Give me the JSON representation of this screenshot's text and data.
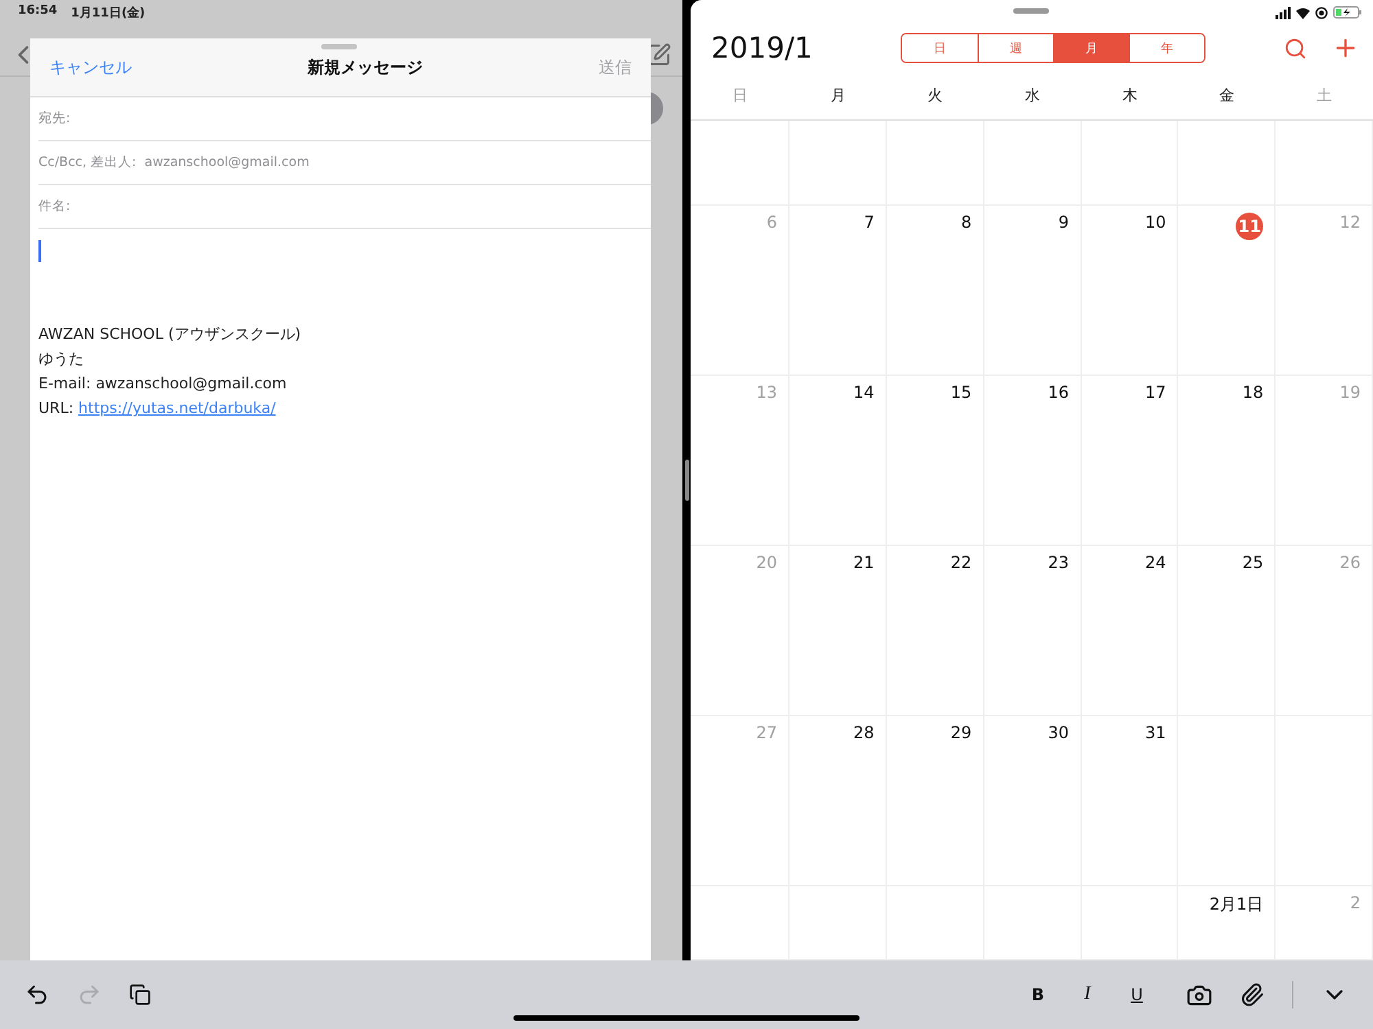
{
  "status_bar": {
    "time": "16:54",
    "date": "1月11日(金)"
  },
  "compose": {
    "cancel": "キャンセル",
    "title": "新規メッセージ",
    "send": {
      "label": "送信",
      "disabled": true
    },
    "fields": [
      {
        "label": "宛先:"
      },
      {
        "label": "Cc/Bcc, 差出人:",
        "value": "awzanschool@gmail.com"
      },
      {
        "label": "件名:"
      }
    ],
    "signature": [
      {
        "text": "AWZAN SCHOOL (アウザンスクール)"
      },
      {
        "text": "ゆうた"
      },
      {
        "text": "E-mail: awzanschool@gmail.com"
      },
      {
        "text": "URL: ",
        "link": "https://yutas.net/darbuka/"
      }
    ]
  },
  "calendar": {
    "title": "2019/1",
    "views": [
      {
        "label": "日",
        "selected": false
      },
      {
        "label": "週",
        "selected": false
      },
      {
        "label": "月",
        "selected": true
      },
      {
        "label": "年",
        "selected": false
      }
    ],
    "weekdays": [
      {
        "label": "日",
        "muted": true
      },
      {
        "label": "月",
        "muted": false
      },
      {
        "label": "火",
        "muted": false
      },
      {
        "label": "水",
        "muted": false
      },
      {
        "label": "木",
        "muted": false
      },
      {
        "label": "金",
        "muted": false
      },
      {
        "label": "土",
        "muted": true
      }
    ],
    "weeks": [
      {
        "kind": "full",
        "days": [
          {
            "day": "6",
            "today": false
          },
          {
            "day": "7",
            "today": false
          },
          {
            "day": "8",
            "today": false
          },
          {
            "day": "9",
            "today": false
          },
          {
            "day": "10",
            "today": false
          },
          {
            "day": "11",
            "today": true
          },
          {
            "day": "12",
            "today": false
          }
        ]
      },
      {
        "kind": "full",
        "days": [
          {
            "day": "13",
            "today": false
          },
          {
            "day": "14",
            "today": false
          },
          {
            "day": "15",
            "today": false
          },
          {
            "day": "16",
            "today": false
          },
          {
            "day": "17",
            "today": false
          },
          {
            "day": "18",
            "today": false
          },
          {
            "day": "19",
            "today": false
          }
        ]
      },
      {
        "kind": "full",
        "days": [
          {
            "day": "20",
            "today": false
          },
          {
            "day": "21",
            "today": false
          },
          {
            "day": "22",
            "today": false
          },
          {
            "day": "23",
            "today": false
          },
          {
            "day": "24",
            "today": false
          },
          {
            "day": "25",
            "today": false
          },
          {
            "day": "26",
            "today": false
          }
        ]
      },
      {
        "kind": "month_end",
        "days": [
          {
            "day": "27",
            "today": false
          },
          {
            "day": "28",
            "today": false
          },
          {
            "day": "29",
            "today": false
          },
          {
            "day": "30",
            "today": false
          },
          {
            "day": "31",
            "today": false
          }
        ]
      },
      {
        "kind": "next_month",
        "days": [
          {
            "day": "2月1日",
            "today": false
          },
          {
            "day": "2",
            "today": false
          }
        ]
      }
    ]
  },
  "toolbar": {
    "redo_disabled": true,
    "format": [
      {
        "kind": "bold",
        "label": "B"
      },
      {
        "kind": "italic",
        "label": "I"
      },
      {
        "kind": "underline",
        "label": "U"
      }
    ]
  }
}
